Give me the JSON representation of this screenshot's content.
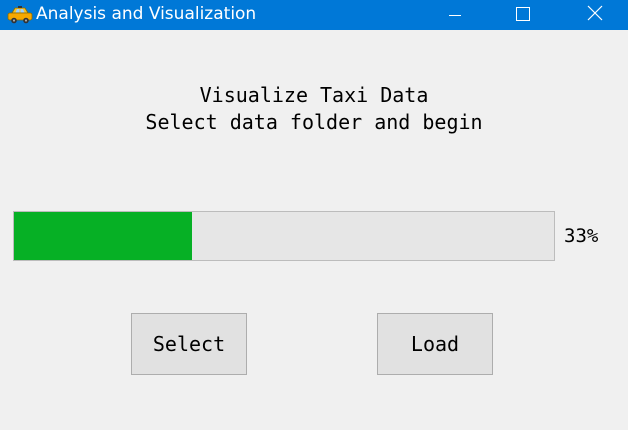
{
  "window": {
    "title": "Analysis and Visualization",
    "app_icon": "taxi-car-icon",
    "controls": {
      "minimize_icon": "minimize-icon",
      "maximize_icon": "maximize-icon",
      "close_icon": "close-icon"
    },
    "titlebar_color": "#0078d7"
  },
  "main": {
    "heading_line1": "Visualize Taxi Data",
    "heading_line2": "Select data folder and begin"
  },
  "progress": {
    "value_fraction": 0.33,
    "label": "33%",
    "fill_color": "#06b025",
    "track_color": "#e6e6e6"
  },
  "buttons": {
    "select_label": "Select",
    "load_label": "Load"
  }
}
